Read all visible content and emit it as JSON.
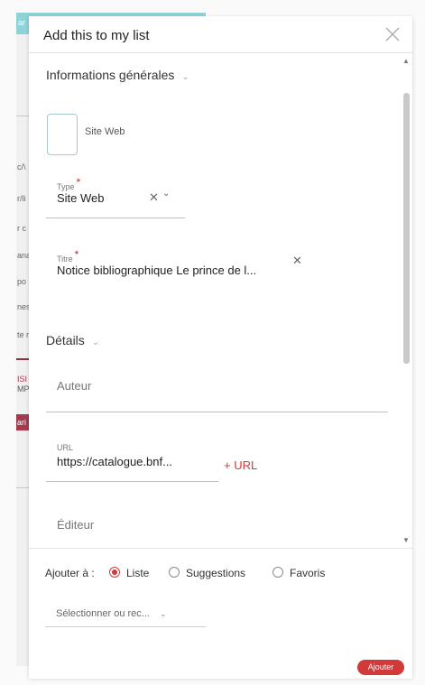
{
  "modal": {
    "title": "Add this to my list"
  },
  "background": {
    "fragments": [
      "ar",
      "c/\\",
      "r/li",
      "r c",
      "ana",
      "po",
      "nes",
      "te r",
      "ISI",
      "MPI",
      "ari"
    ]
  },
  "general": {
    "heading": "Informations générales",
    "thumb_label": "Site Web",
    "type_label": "Type",
    "type_value": "Site Web",
    "title_label": "Titre",
    "title_value": "Notice bibliographique Le prince de l..."
  },
  "details": {
    "heading": "Détails",
    "author_placeholder": "Auteur",
    "url_label": "URL",
    "url_value": "https://catalogue.bnf...",
    "add_url": "+ URL",
    "publisher_placeholder": "Éditeur"
  },
  "footer": {
    "add_to_label": "Ajouter à :",
    "options": [
      "Liste",
      "Suggestions",
      "Favoris"
    ],
    "selected_option": "Liste",
    "select_placeholder": "Sélectionner ou rec...",
    "submit_label": "Ajouter"
  },
  "colors": {
    "accent": "#d23939",
    "topbar": "#8ed3d7",
    "thumb_border": "#a7c6d4"
  },
  "icons": [
    "close-icon",
    "chevron-down-icon",
    "clear-icon",
    "scroll-up-icon",
    "scroll-down-icon"
  ]
}
